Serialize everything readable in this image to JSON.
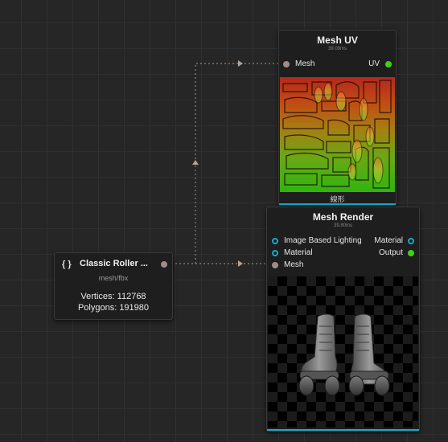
{
  "nodes": {
    "mesh_uv": {
      "title": "Mesh UV",
      "time": "39.09ms",
      "input_label": "Mesh",
      "output_label": "UV",
      "caption": "線形"
    },
    "mesh_render": {
      "title": "Mesh Render",
      "time": "39.80ms",
      "inputs": [
        "Image Based Lighting",
        "Material",
        "Mesh"
      ],
      "outputs": [
        "Material",
        "Output"
      ]
    },
    "source": {
      "icon": "{ }",
      "title": "Classic Roller ...",
      "type": "mesh/fbx",
      "vertices": "Vertices: 112768",
      "polygons": "Polygons: 191980"
    }
  },
  "colors": {
    "mesh_socket": "#a08c82",
    "uv_socket": "#3ed11a",
    "image_socket": "#18a8c8",
    "accent": "#1aa7c9",
    "canvas": "#262626"
  }
}
